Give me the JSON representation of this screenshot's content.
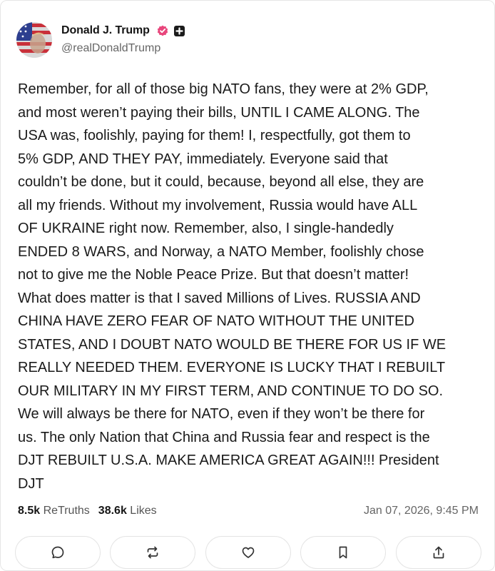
{
  "post": {
    "author": {
      "display_name": "Donald J. Trump",
      "handle": "@realDonaldTrump",
      "verified_icon": "verified-badge-icon",
      "extra_icon": "plus-icon"
    },
    "body_lines": [
      "Remember, for all of those big NATO fans, they were at 2% GDP,",
      "and most weren’t paying their bills, UNTIL I CAME ALONG. The",
      "USA was, foolishly, paying for them! I, respectfully, got them to",
      "5% GDP, AND THEY PAY, immediately. Everyone said that",
      "couldn’t be done, but it could, because, beyond all else, they are",
      "all my friends. Without my involvement, Russia would have ALL",
      "OF UKRAINE right now. Remember, also, I single-handedly",
      "ENDED 8 WARS, and Norway, a NATO Member, foolishly chose",
      "not to give me the Noble Peace Prize. But that doesn’t matter!",
      "What does matter is that I saved Millions of Lives. RUSSIA AND",
      "CHINA HAVE ZERO FEAR OF NATO WITHOUT THE UNITED",
      "STATES, AND I DOUBT NATO WOULD BE THERE FOR US IF WE",
      "REALLY NEEDED THEM. EVERYONE IS LUCKY THAT I REBUILT",
      "OUR MILITARY IN MY FIRST TERM, AND CONTINUE TO DO SO.",
      "We will always be there for NATO, even if they won’t be there for",
      "us. The only Nation that China and Russia fear and respect is the",
      "DJT REBUILT U.S.A. MAKE AMERICA GREAT AGAIN!!! President",
      "DJT"
    ],
    "stats": {
      "retruths_count": "8.5k",
      "retruths_label": "ReTruths",
      "likes_count": "38.6k",
      "likes_label": "Likes"
    },
    "timestamp": "Jan 07, 2026, 9:45 PM",
    "actions": [
      {
        "name": "reply",
        "icon": "comment-icon"
      },
      {
        "name": "retruth",
        "icon": "repost-icon"
      },
      {
        "name": "like",
        "icon": "heart-icon"
      },
      {
        "name": "bookmark",
        "icon": "bookmark-icon"
      },
      {
        "name": "share",
        "icon": "share-icon"
      }
    ]
  },
  "colors": {
    "verified_badge": "#e8467c",
    "text_primary": "#1a1a1a",
    "text_secondary": "#666666",
    "border": "#e4e4e4",
    "icon": "#333333"
  }
}
